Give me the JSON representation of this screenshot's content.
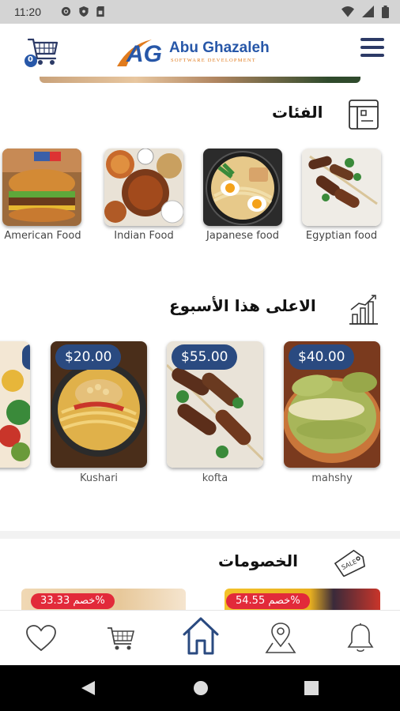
{
  "status_bar": {
    "time": "11:20",
    "left_icons": [
      "gear-icon",
      "shield-icon",
      "sim-card-icon"
    ],
    "right_icons": [
      "wifi-icon",
      "signal-icon",
      "battery-icon"
    ]
  },
  "header": {
    "logo_mark": "AG",
    "logo_name": "Abu Ghazaleh",
    "logo_subtitle": "SOFTWARE DEVELOPMENT",
    "cart_badge": "0",
    "colors": {
      "brand_blue": "#2757a8",
      "brand_orange": "#e07b1e",
      "navy": "#2a4a80"
    }
  },
  "categories": {
    "title": "الفئات",
    "items": [
      {
        "label": "American Food"
      },
      {
        "label": "Indian Food"
      },
      {
        "label": "Japanese food"
      },
      {
        "label": "Egyptian food"
      }
    ]
  },
  "top_week": {
    "title": "الاعلى هذا الأسبوع",
    "items": [
      {
        "label": "Kushari",
        "price": "$20.00"
      },
      {
        "label": "kofta",
        "price": "$55.00"
      },
      {
        "label": "mahshy",
        "price": "$40.00"
      }
    ]
  },
  "discounts": {
    "title": "الخصومات",
    "items": [
      {
        "badge": "خصم 33.33%"
      },
      {
        "badge": "خصم 54.55%"
      }
    ]
  },
  "bottom_nav": {
    "items": [
      "heart-icon",
      "cart-icon",
      "home-icon",
      "location-icon",
      "bell-icon"
    ],
    "active": "home-icon"
  },
  "system_nav": [
    "back-icon",
    "home-circle-icon",
    "recents-icon"
  ]
}
